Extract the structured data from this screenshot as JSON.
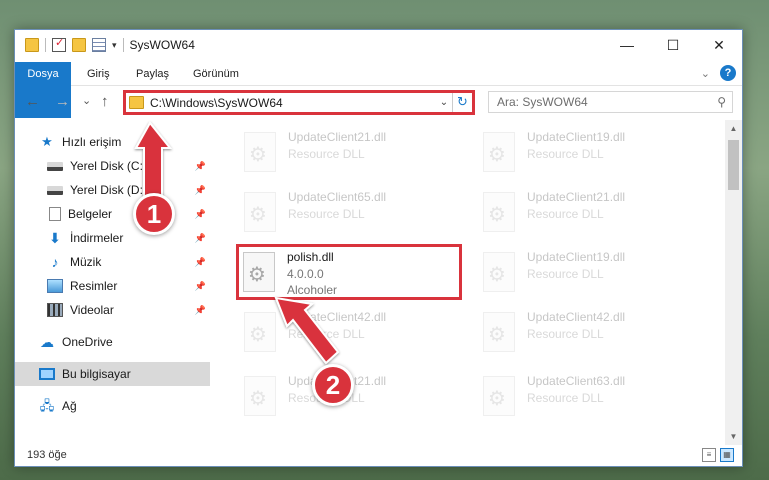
{
  "window": {
    "title": "SysWOW64",
    "controls": {
      "minimize": "—",
      "maximize": "☐",
      "close": "✕"
    }
  },
  "ribbon": {
    "tabs": [
      {
        "label": "Dosya"
      },
      {
        "label": "Giriş"
      },
      {
        "label": "Paylaş"
      },
      {
        "label": "Görünüm"
      }
    ]
  },
  "navigation": {
    "back": "←",
    "forward": "→",
    "recent": "⌄",
    "up": "↑",
    "address": "C:\\Windows\\SysWOW64",
    "search_placeholder": "Ara: SysWOW64"
  },
  "sidebar": {
    "items": [
      {
        "label": "Hızlı erişim",
        "icon": "star-icon",
        "pinned": false
      },
      {
        "label": "Yerel Disk (C:)",
        "icon": "drive-icon",
        "pinned": true
      },
      {
        "label": "Yerel Disk (D:)",
        "icon": "drive-icon",
        "pinned": true
      },
      {
        "label": "Belgeler",
        "icon": "documents-icon",
        "pinned": true
      },
      {
        "label": "İndirmeler",
        "icon": "downloads-icon",
        "pinned": true
      },
      {
        "label": "Müzik",
        "icon": "music-icon",
        "pinned": true
      },
      {
        "label": "Resimler",
        "icon": "pictures-icon",
        "pinned": true
      },
      {
        "label": "Videolar",
        "icon": "videos-icon",
        "pinned": true
      },
      {
        "label": "OneDrive",
        "icon": "cloud-icon",
        "pinned": false
      },
      {
        "label": "Bu bilgisayar",
        "icon": "computer-icon",
        "pinned": false
      },
      {
        "label": "Ağ",
        "icon": "network-icon",
        "pinned": false
      }
    ]
  },
  "files": {
    "background": [
      {
        "name": "UpdateClient21.dll",
        "desc": "Resource DLL"
      },
      {
        "name": "UpdateClient19.dll",
        "desc": "Resource DLL"
      },
      {
        "name": "UpdateClient65.dll",
        "desc": "Resource DLL"
      },
      {
        "name": "UpdateClient21.dll",
        "desc": "Resource DLL"
      },
      {
        "name": "UpdateClient19.dll",
        "desc": "Resource DLL"
      },
      {
        "name": "UpdateClient42.dll",
        "desc": "Resource DLL"
      },
      {
        "name": "UpdateClient42.dll",
        "desc": "Resource DLL"
      },
      {
        "name": "UpdateClient21.dll",
        "desc": "Resource DLL"
      },
      {
        "name": "UpdateClient63.dll",
        "desc": "Resource DLL"
      }
    ],
    "highlighted": {
      "name": "polish.dll",
      "version": "4.0.0.0",
      "company": "Alcoholer"
    }
  },
  "status": {
    "item_count": "193 öğe"
  },
  "annotations": {
    "step1": "1",
    "step2": "2"
  },
  "colors": {
    "accent": "#1979ca",
    "highlight": "#d9333c"
  }
}
